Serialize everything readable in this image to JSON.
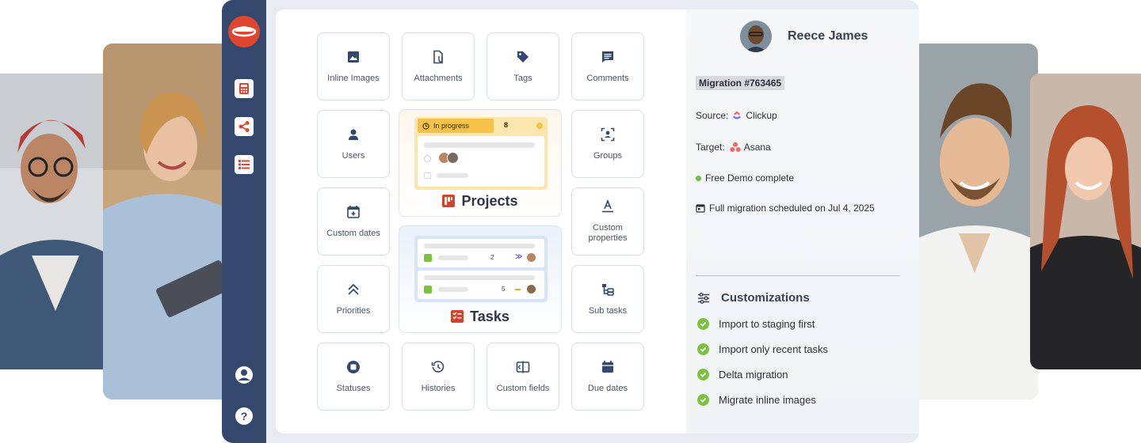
{
  "grid": {
    "inline_images": "Inline Images",
    "attachments": "Attachments",
    "tags": "Tags",
    "comments": "Comments",
    "users": "Users",
    "groups": "Groups",
    "custom_dates": "Custom dates",
    "custom_properties": "Custom properties",
    "priorities": "Priorities",
    "sub_tasks": "Sub tasks",
    "statuses": "Statuses",
    "histories": "Histories",
    "custom_fields": "Custom fields",
    "due_dates": "Due dates"
  },
  "projects_card": {
    "title": "Projects",
    "status_label": "In progress",
    "count": "8"
  },
  "tasks_card": {
    "title": "Tasks",
    "row1_count": "2",
    "row2_count": "5"
  },
  "details": {
    "user_name": "Reece James",
    "migration_id": "Migration #763465",
    "source_label": "Source:",
    "source_name": "Clickup",
    "target_label": "Target:",
    "target_name": "Asana",
    "demo_status": "Free Demo complete",
    "scheduled": "Full migration scheduled on Jul 4, 2025",
    "customizations_title": "Customizations",
    "customizations": [
      "Import to staging first",
      "Import only recent tasks",
      "Delta migration",
      "Migrate inline images"
    ]
  },
  "colors": {
    "rail": "#34486d",
    "accent": "#e0462f",
    "check": "#7cc242",
    "status_green": "#6cc04a"
  }
}
